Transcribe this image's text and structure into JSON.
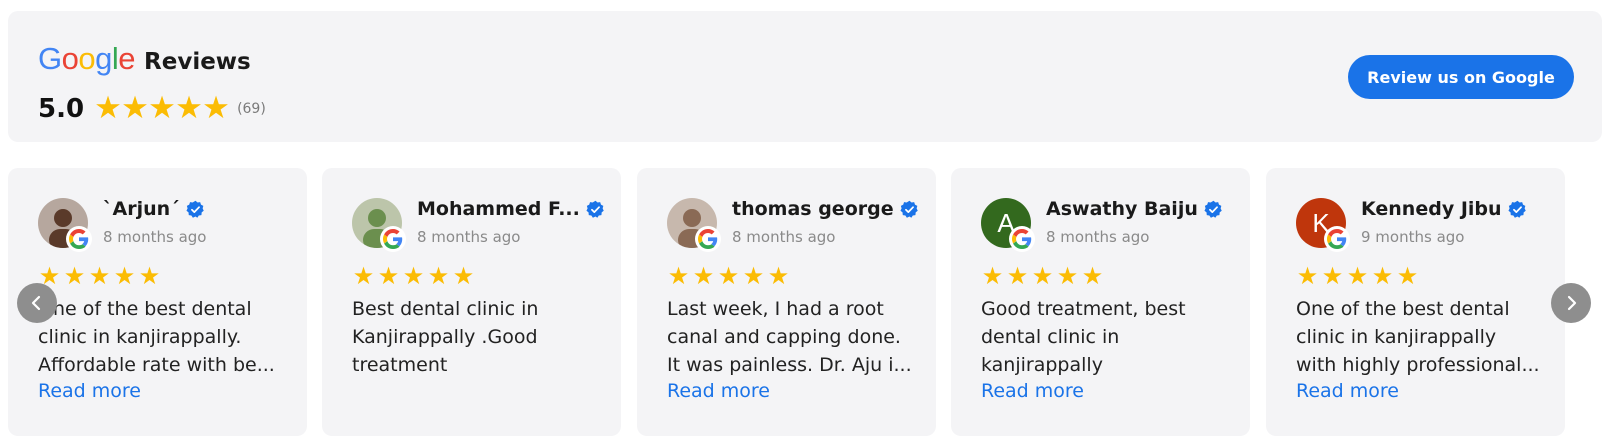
{
  "header": {
    "brand_google": "Google",
    "brand_reviews": "Reviews",
    "rating": "5.0",
    "stars": 5,
    "count": "(69)",
    "cta_label": "Review us on Google"
  },
  "colors": {
    "star": "#fbbc04",
    "link": "#1a73e8",
    "google_blue": "#4285f4",
    "google_red": "#ea4335",
    "google_yellow": "#fbbc05",
    "google_green": "#34a853"
  },
  "reviews": [
    {
      "name": "`Arjun´",
      "date": "8 months ago",
      "stars": 5,
      "lines": [
        "One of the best dental",
        "clinic in kanjirappally.",
        "Affordable rate with be..."
      ],
      "read_more": "Read more",
      "avatar_initial": "",
      "avatar_color": "#5a3a2a"
    },
    {
      "name": "Mohammed F...",
      "date": "8 months ago",
      "stars": 5,
      "lines": [
        "Best dental clinic in",
        "Kanjirappally .Good",
        "treatment"
      ],
      "read_more": "",
      "avatar_initial": "",
      "avatar_color": "#6b8f4e"
    },
    {
      "name": "thomas george",
      "date": "8 months ago",
      "stars": 5,
      "lines": [
        "Last week, I had a root",
        "canal and capping done.",
        "It was painless. Dr. Aju i..."
      ],
      "read_more": "Read more",
      "avatar_initial": "",
      "avatar_color": "#8a6a55"
    },
    {
      "name": "Aswathy Baiju",
      "date": "8 months ago",
      "stars": 5,
      "lines": [
        "Good treatment, best",
        "dental clinic in",
        "kanjirappally"
      ],
      "read_more": "Read more",
      "avatar_initial": "A",
      "avatar_color": "#33691e"
    },
    {
      "name": "Kennedy Jibu",
      "date": "9 months ago",
      "stars": 5,
      "lines": [
        "One of the best dental",
        "clinic in kanjirappally",
        "with highly professional..."
      ],
      "read_more": "Read more",
      "avatar_initial": "K",
      "avatar_color": "#bf360c"
    }
  ],
  "nav": {
    "prev_icon": "chevron-left-icon",
    "next_icon": "chevron-right-icon"
  }
}
